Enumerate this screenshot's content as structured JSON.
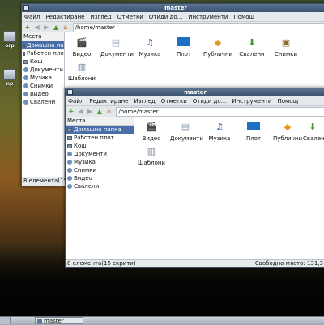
{
  "desktop": {
    "icons": [
      {
        "label": "orp"
      },
      {
        "label": "np"
      }
    ]
  },
  "back_window": {
    "title": "master",
    "menu": [
      "Файл",
      "Редактиране",
      "Изглед",
      "Отметки",
      "Отиди до...",
      "Инструменти",
      "Помощ"
    ],
    "address": "/home/master",
    "sidebar": {
      "header": "Места",
      "items": [
        "Домашна папка",
        "Работен плот",
        "Кош",
        "Документи",
        "Музика",
        "Снимки",
        "Видео",
        "Свалени"
      ]
    },
    "files": [
      "Видео",
      "Документи",
      "Музика",
      "Плот",
      "Публични",
      "Свалени",
      "Снимки",
      "Шаблони"
    ],
    "status_left": "8 елемента(15 скрити)"
  },
  "front_window": {
    "title": "master",
    "menu": [
      "Файл",
      "Редактиране",
      "Изглед",
      "Отметки",
      "Отиди до...",
      "Инструменти",
      "Помощ"
    ],
    "address": "/home/master",
    "sidebar": {
      "header": "Места",
      "items": [
        "Домашна папка",
        "Работен плот",
        "Кош",
        "Документи",
        "Музика",
        "Снимки",
        "Видео",
        "Свалени"
      ]
    },
    "files": [
      "Видео",
      "Документи",
      "Музика",
      "Плот",
      "Публични",
      "Свалени",
      "Шаблони"
    ],
    "status_left": "8 елемента(15 скрити)",
    "status_right": "Свободно място: 131,3"
  },
  "taskbar": {
    "window_label": "master"
  },
  "colors": {
    "selection": "#4a6ea8",
    "titlebar": "#4a6380"
  }
}
